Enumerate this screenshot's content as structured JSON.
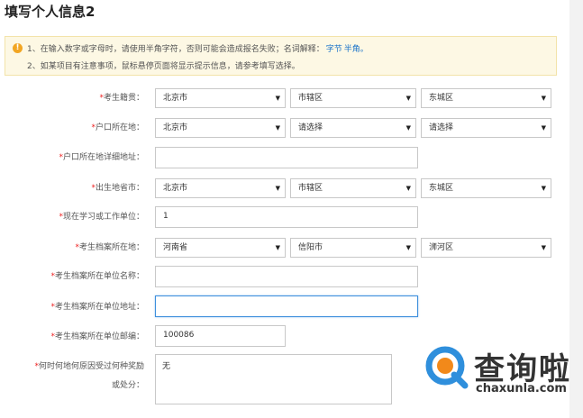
{
  "page_title": "填写个人信息2",
  "notice": {
    "line1": "1、在输入数字或字母时，请使用半角字符，否则可能会造成报名失败；名词解释：",
    "link1": "字节",
    "link2": "半角。",
    "line2": "2、如某项目有注意事项，鼠标悬停页面将显示提示信息，请参考填写选择。"
  },
  "form": {
    "native_place": {
      "label": "考生籍贯：",
      "province": "北京市",
      "city": "市辖区",
      "district": "东城区"
    },
    "hukou": {
      "label": "户口所在地：",
      "province": "北京市",
      "city": "请选择",
      "district": "请选择"
    },
    "hukou_address": {
      "label": "户口所在地详细地址：",
      "value": ""
    },
    "birthplace": {
      "label": "出生地省市：",
      "province": "北京市",
      "city": "市辖区",
      "district": "东城区"
    },
    "work_unit": {
      "label": "现在学习或工作单位：",
      "value": "1"
    },
    "archive_location": {
      "label": "考生档案所在地：",
      "province": "河南省",
      "city": "信阳市",
      "district": "浉河区"
    },
    "archive_unit_name": {
      "label": "考生档案所在单位名称：",
      "value": ""
    },
    "archive_unit_address": {
      "label": "考生档案所在单位地址：",
      "value": ""
    },
    "archive_postcode": {
      "label": "考生档案所在单位邮编：",
      "value": "100086"
    },
    "awards": {
      "label_line1": "何时何地何原因受过何种奖励",
      "label_line2": "或处分：",
      "value": "无"
    }
  },
  "required_mark": "*",
  "dropdown_glyph": "▼",
  "notice_icon": "!",
  "watermark": {
    "brand_cn": "查询啦",
    "brand_en": "chaxunla.com",
    "icon": "magnifier-q-icon"
  },
  "colors": {
    "notice_bg": "#fdf8e4",
    "link": "#1b73c9",
    "required": "#e22222",
    "focus_border": "#3d8fdc",
    "logo_blue": "#2f8fdc",
    "logo_orange": "#f2891a"
  }
}
